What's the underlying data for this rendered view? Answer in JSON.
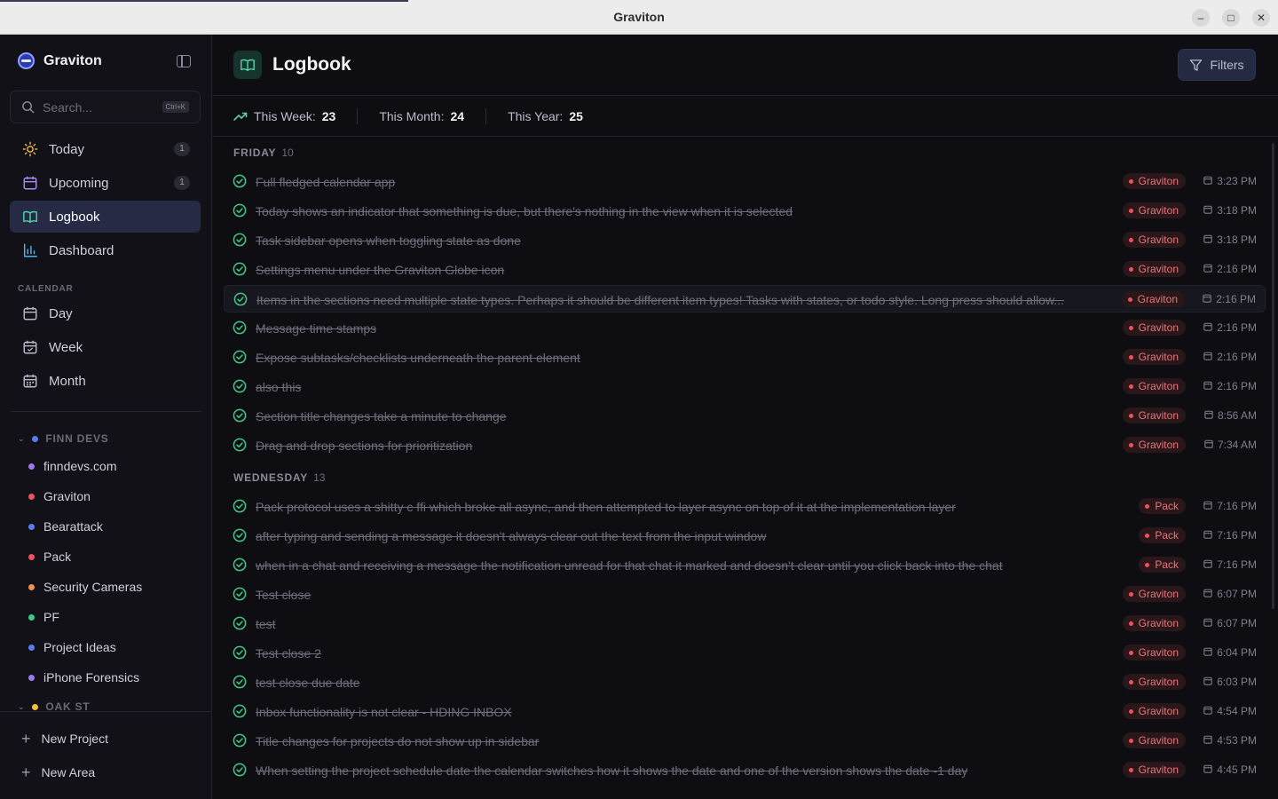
{
  "window": {
    "title": "Graviton",
    "minimize": "–",
    "maximize": "□",
    "close": "✕"
  },
  "sidebar": {
    "brand": "Graviton",
    "search": {
      "placeholder": "Search...",
      "shortcut": "Ctrl+K"
    },
    "nav": [
      {
        "label": "Today",
        "icon": "sun-icon",
        "badge": "1"
      },
      {
        "label": "Upcoming",
        "icon": "calendar-icon",
        "badge": "1"
      },
      {
        "label": "Logbook",
        "icon": "book-open-icon",
        "badge": ""
      },
      {
        "label": "Dashboard",
        "icon": "bar-chart-icon",
        "badge": ""
      }
    ],
    "calendar_label": "CALENDAR",
    "calendar": [
      {
        "label": "Day",
        "icon": "calendar-icon"
      },
      {
        "label": "Week",
        "icon": "calendar-week-icon"
      },
      {
        "label": "Month",
        "icon": "calendar-month-icon"
      }
    ],
    "areas": [
      {
        "name": "FINN DEVS",
        "color": "#5b7cf0",
        "projects": [
          {
            "name": "finndevs.com",
            "color": "#9b7be8"
          },
          {
            "name": "Graviton",
            "color": "#e8545f"
          },
          {
            "name": "Bearattack",
            "color": "#5b7cf0"
          },
          {
            "name": "Pack",
            "color": "#e8545f"
          },
          {
            "name": "Security Cameras",
            "color": "#f0904a"
          },
          {
            "name": "PF",
            "color": "#3cc98a"
          },
          {
            "name": "Project Ideas",
            "color": "#5b7cf0"
          },
          {
            "name": "iPhone Forensics",
            "color": "#9b7be8"
          }
        ]
      },
      {
        "name": "OAK ST",
        "color": "#f0c23a",
        "projects": []
      }
    ],
    "new_project": "New Project",
    "new_area": "New Area"
  },
  "main": {
    "title": "Logbook",
    "icon": "book-open-icon",
    "filters_label": "Filters",
    "stats": [
      {
        "label": "This Week:",
        "value": "23"
      },
      {
        "label": "This Month:",
        "value": "24"
      },
      {
        "label": "This Year:",
        "value": "25"
      }
    ],
    "groups": [
      {
        "day": "FRIDAY",
        "count": "10",
        "tasks": [
          {
            "text": "Full fledged calendar app",
            "project": "Graviton",
            "time": "3:23 PM"
          },
          {
            "text": "Today shows an indicator that something is due, but there's nothing in the view when it is selected",
            "project": "Graviton",
            "time": "3:18 PM"
          },
          {
            "text": "Task sidebar opens when toggling state as done",
            "project": "Graviton",
            "time": "3:18 PM"
          },
          {
            "text": "Settings menu under the Graviton Globe icon",
            "project": "Graviton",
            "time": "2:16 PM"
          },
          {
            "text": "Items in the sections need multiple state types. Perhaps it should be different item types! Tasks with states, or todo style. Long press should allow...",
            "project": "Graviton",
            "time": "2:16 PM"
          },
          {
            "text": "Message time stamps",
            "project": "Graviton",
            "time": "2:16 PM"
          },
          {
            "text": "Expose subtasks/checklists underneath the parent element",
            "project": "Graviton",
            "time": "2:16 PM"
          },
          {
            "text": "also this",
            "project": "Graviton",
            "time": "2:16 PM"
          },
          {
            "text": "Section title changes take a minute to change",
            "project": "Graviton",
            "time": "8:56 AM"
          },
          {
            "text": "Drag and drop sections for prioritization",
            "project": "Graviton",
            "time": "7:34 AM"
          }
        ]
      },
      {
        "day": "WEDNESDAY",
        "count": "13",
        "tasks": [
          {
            "text": "Pack protocol uses a shitty c ffi which broke all async, and then attempted to layer async on top of it at the implementation layer",
            "project": "Pack",
            "time": "7:16 PM"
          },
          {
            "text": "after typing and sending a message it doesn't always clear out the text from the input window",
            "project": "Pack",
            "time": "7:16 PM"
          },
          {
            "text": "when in a chat and receiving a message the notification unread for that chat it marked and doesn't clear until you click back into the chat",
            "project": "Pack",
            "time": "7:16 PM"
          },
          {
            "text": "Test close",
            "project": "Graviton",
            "time": "6:07 PM"
          },
          {
            "text": "test",
            "project": "Graviton",
            "time": "6:07 PM"
          },
          {
            "text": "Test close 2",
            "project": "Graviton",
            "time": "6:04 PM"
          },
          {
            "text": "test close due date",
            "project": "Graviton",
            "time": "6:03 PM"
          },
          {
            "text": "Inbox functionality is not clear - HDING INBOX",
            "project": "Graviton",
            "time": "4:54 PM"
          },
          {
            "text": "Title changes for projects do not show up in sidebar",
            "project": "Graviton",
            "time": "4:53 PM"
          },
          {
            "text": "When setting the project schedule date the calendar switches how it shows the date and one of the version shows the date -1 day",
            "project": "Graviton",
            "time": "4:45 PM"
          }
        ]
      }
    ]
  },
  "colors": {
    "accent": "#5b7cf0",
    "project_pill_text": "#e8747d",
    "check": "#3cc98a",
    "background": "#0d0d12"
  }
}
